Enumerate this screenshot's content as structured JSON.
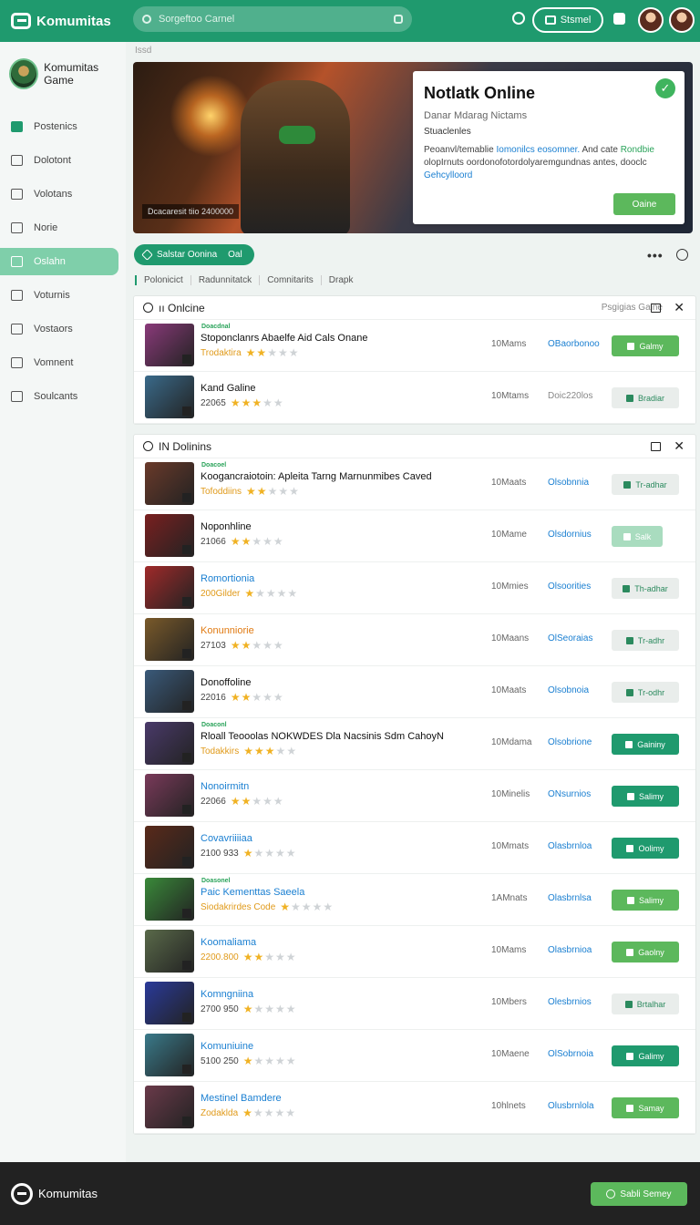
{
  "app": {
    "name": "Komumitas"
  },
  "search": {
    "placeholder": "Sorgeftoo Carnel"
  },
  "topbar": {
    "button_label": "Stsmel"
  },
  "sidebar": {
    "brand": "Komumitas Game",
    "items": [
      {
        "label": "Postenics",
        "icon": "home-icon"
      },
      {
        "label": "Dolotont",
        "icon": "link-icon"
      },
      {
        "label": "Volotans",
        "icon": "bag-icon"
      },
      {
        "label": "Norie",
        "icon": "folder-icon"
      },
      {
        "label": "Oslahn",
        "icon": "book-icon",
        "active": true
      },
      {
        "label": "Voturnis",
        "icon": "circle-icon"
      },
      {
        "label": "Vostaors",
        "icon": "bag-icon"
      },
      {
        "label": "Vomnent",
        "icon": "grid-icon"
      },
      {
        "label": "Soulcants",
        "icon": "note-icon"
      }
    ]
  },
  "breadcrumb": "Issd",
  "hero": {
    "caption": "Dcacaresit tiio 2400000",
    "card_title": "Notlatk Online",
    "card_sub": "Danar Mdarag Nictams",
    "card_label": "Stuaclenles",
    "card_desc_parts": [
      "Peoanvl/temablie ",
      "Iomonilcs eosomner.",
      " And cate ",
      "Rondbie",
      " olopIrnuts oordonofotordolyaremgundnas antes, dooclc ",
      "Gehcylloord"
    ],
    "card_button": "Oaine"
  },
  "filter": {
    "pill_label": "Salstar Oonina",
    "pill_badge": "Oal"
  },
  "tabs": [
    "Polonicict",
    "Radunnitatck",
    "Comnitarits",
    "Drapk"
  ],
  "panels": [
    {
      "title": "ıı Onlcine",
      "right_label": "Psgigias Gaine",
      "rows": [
        {
          "tag": "Doacdnal",
          "title": "Stoponclanrs Abaelfe Aid Cals Onane",
          "title_color": "blue-mixed",
          "meta": "Trodaktira",
          "meta_color": "orange",
          "rating": 2,
          "size": "10Mams",
          "link": "OBaorbonoo",
          "button": "Galmy",
          "button_style": "green",
          "thumb": "#8a3a7a"
        },
        {
          "title": "Kand Galine",
          "meta": "22065",
          "rating": 3,
          "size": "10Mtams",
          "link": "Doic220los",
          "link_grey": true,
          "button": "Bradiar",
          "button_style": "grey",
          "thumb": "#3a6a8a"
        }
      ]
    },
    {
      "title": "IN Dolinins",
      "right_label": "",
      "rows": [
        {
          "tag": "Doacoel",
          "title": "Koogancraiotoin: Apleita Tarng Marnunmibes Caved",
          "meta": "Tofoddiins",
          "meta_color": "orange",
          "rating": 2,
          "size": "10Maats",
          "link": "Olsobnnia",
          "button": "Tr-adhar",
          "button_style": "grey",
          "thumb": "#6a3a2a"
        },
        {
          "title": "Noponhline",
          "meta": "21066",
          "rating": 2,
          "size": "10Mame",
          "link": "Olsdornius",
          "button": "Salk",
          "button_style": "light",
          "thumb": "#7a2020"
        },
        {
          "title": "Romortionia",
          "title_color": "blue",
          "meta": "200Gilder",
          "meta_color": "orange",
          "rating": 1,
          "size": "10Mmies",
          "link": "Olsoorities",
          "button": "Th-adhar",
          "button_style": "grey",
          "thumb": "#a02a2a"
        },
        {
          "title": "Konunniorie",
          "title_color": "orange",
          "meta": "27103",
          "rating": 2,
          "size": "10Maans",
          "link": "OlSeoraias",
          "button": "Tr-adhr",
          "button_style": "grey",
          "thumb": "#7a5a2a"
        },
        {
          "title": "Donoffoline",
          "meta": "22016",
          "rating": 2,
          "size": "10Maats",
          "link": "Olsobnoia",
          "button": "Tr-odhr",
          "button_style": "grey",
          "thumb": "#3a5a7a"
        },
        {
          "tag": "Doaconl",
          "title": "Rloall Teooolas NOKWDES Dla Nacsinis Sdm CahoyN",
          "meta": "Todakkirs",
          "meta_color": "orange",
          "rating": 3,
          "size": "10Mdama",
          "link": "Olsobrione",
          "button": "Gaininy",
          "button_style": "teal",
          "thumb": "#4a3a6a"
        },
        {
          "title": "Nonoirmitn",
          "title_color": "blue",
          "meta": "22066",
          "rating": 2,
          "size": "10Minelis",
          "link": "ONsurnios",
          "button": "Salimy",
          "button_style": "teal",
          "thumb": "#7a3a5a"
        },
        {
          "title": "Covavriiiiaa",
          "title_color": "blue",
          "meta": "2100 933",
          "rating": 1,
          "size": "10Mmats",
          "link": "Olasbrnloa",
          "button": "Oolimy",
          "button_style": "teal",
          "thumb": "#5a2a1a"
        },
        {
          "tag": "Doasonel",
          "title": "Paic Kementtas Saeela",
          "title_color": "blue",
          "meta": "Siodakrirdes Code",
          "meta_color": "orange",
          "rating": 1,
          "size": "1AMnats",
          "link": "Olasbrnlsa",
          "button": "Salimy",
          "button_style": "green",
          "thumb": "#3a8a3a"
        },
        {
          "title": "Koomaliama",
          "title_color": "blue",
          "meta": "2200.800",
          "meta_color": "orange",
          "rating": 2,
          "size": "10Mams",
          "link": "Olasbrnioa",
          "button": "Gaolny",
          "button_style": "green",
          "thumb": "#5a6a4a"
        },
        {
          "title": "Komngniina",
          "title_color": "blue",
          "meta": "2700 950",
          "rating": 1,
          "size": "10Mbers",
          "link": "Olesbrnios",
          "button": "Brtalhar",
          "button_style": "grey",
          "thumb": "#2a3a9a"
        },
        {
          "title": "Komuniuine",
          "title_color": "blue",
          "meta": "5100 250",
          "rating": 1,
          "size": "10Maene",
          "link": "OlSobrnoia",
          "button": "Galimy",
          "button_style": "teal",
          "thumb": "#3a7a8a"
        },
        {
          "title": "Mestinel Bamdere",
          "title_color": "blue",
          "meta": "Zodaklda",
          "meta_color": "orange",
          "rating": 1,
          "size": "10hlnets",
          "link": "Olusbrnlola",
          "button": "Samay",
          "button_style": "green",
          "thumb": "#6a3a4a"
        }
      ]
    }
  ],
  "footer": {
    "name": "Komumitas",
    "button": "Sabli Semey"
  },
  "colors": {
    "brand": "#1f9a6e",
    "accent_green": "#5cb85c",
    "link_blue": "#1a7fd1"
  }
}
